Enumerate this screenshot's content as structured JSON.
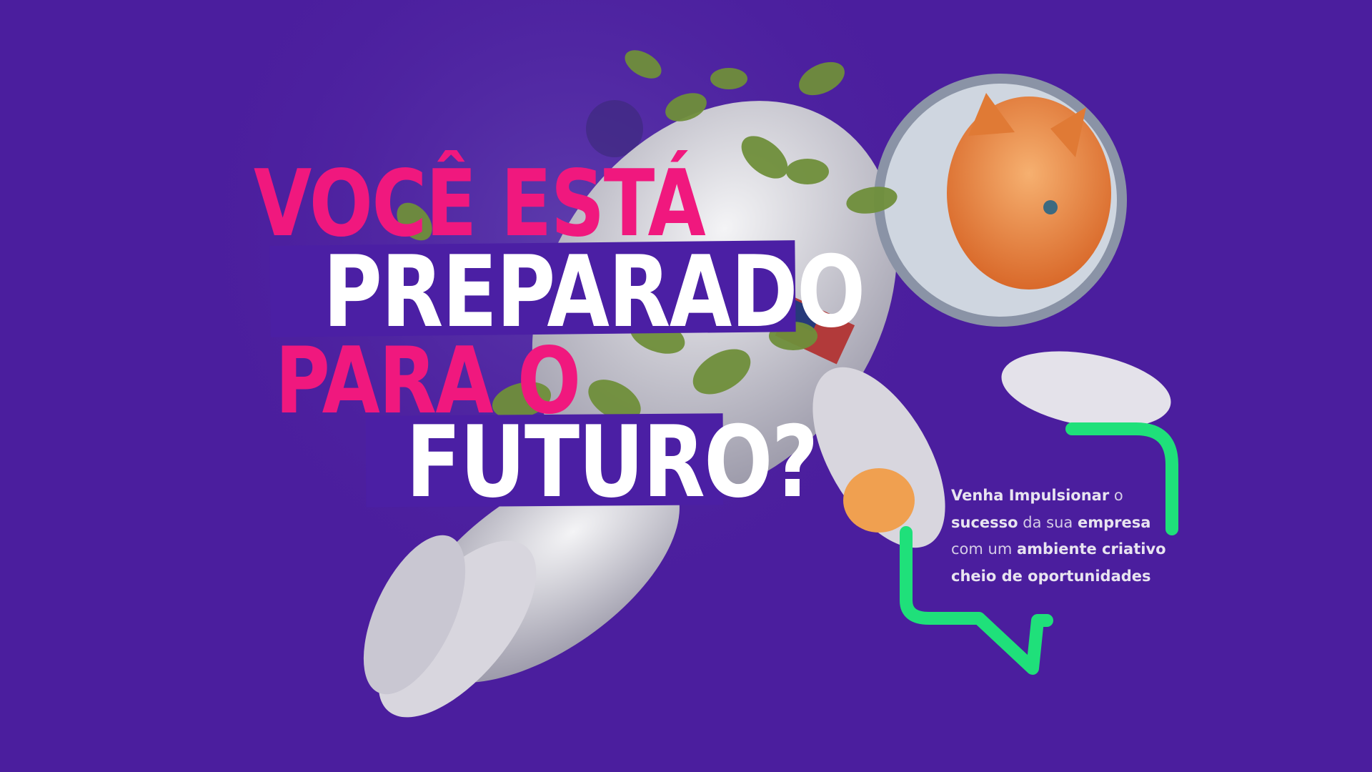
{
  "headline": {
    "line1": "VOCÊ ESTÁ",
    "line2": "PREPARADO",
    "line3": "PARA O",
    "line4": "FUTURO?"
  },
  "copy": {
    "l1_bold": "Venha Impulsionar",
    "l1_light": "o",
    "l2_bold1": "sucesso",
    "l2_light": "da sua",
    "l2_bold2": "empresa",
    "l3_light": "com um",
    "l3_bold": "ambiente criativo",
    "l4_bold": "cheio de oportunidades"
  },
  "colors": {
    "background": "#4b1e9e",
    "headline_pink": "#f0187e",
    "band_purple": "#4b1fa4",
    "bubble_green": "#1fe07a"
  },
  "illustration": "cat-astronaut-with-leaves"
}
